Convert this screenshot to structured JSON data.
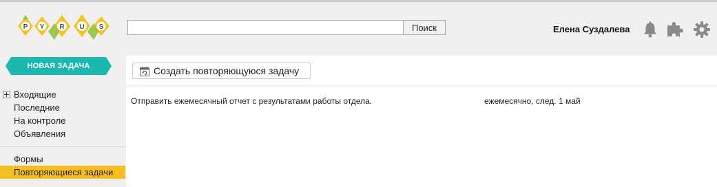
{
  "brand": {
    "logo_letters": [
      "P",
      "Y",
      "R",
      "U",
      "S"
    ]
  },
  "header": {
    "search_placeholder": "",
    "search_button": "Поиск",
    "user_name": "Елена Суздалева"
  },
  "icons": {
    "notifications": "bell-icon",
    "extensions": "puzzle-icon",
    "settings": "gear-icon",
    "inbox_expand": "plus-box-icon",
    "recurring": "calendar-repeat-icon"
  },
  "sidebar": {
    "new_task_label": "НОВАЯ ЗАДАЧА",
    "section1": [
      {
        "label": "Входящие"
      },
      {
        "label": "Последние"
      },
      {
        "label": "На контроле"
      },
      {
        "label": "Объявления"
      }
    ],
    "section2": [
      {
        "label": "Формы"
      },
      {
        "label": "Повторяющиеся задачи",
        "active": true
      }
    ]
  },
  "main": {
    "create_button_label": "Создать повторяющуюся задачу",
    "tasks": [
      {
        "title": "Отправить ежемесячный отчет с результатами работы отдела.",
        "schedule": "ежемесячно, след. 1 май"
      }
    ]
  },
  "colors": {
    "accent_teal": "#1ab8ae",
    "active_yellow": "#f7be1f",
    "logo_yellow": "#f6c21c",
    "logo_green": "#8fc43f",
    "icon_gray": "#8a8a8a"
  }
}
